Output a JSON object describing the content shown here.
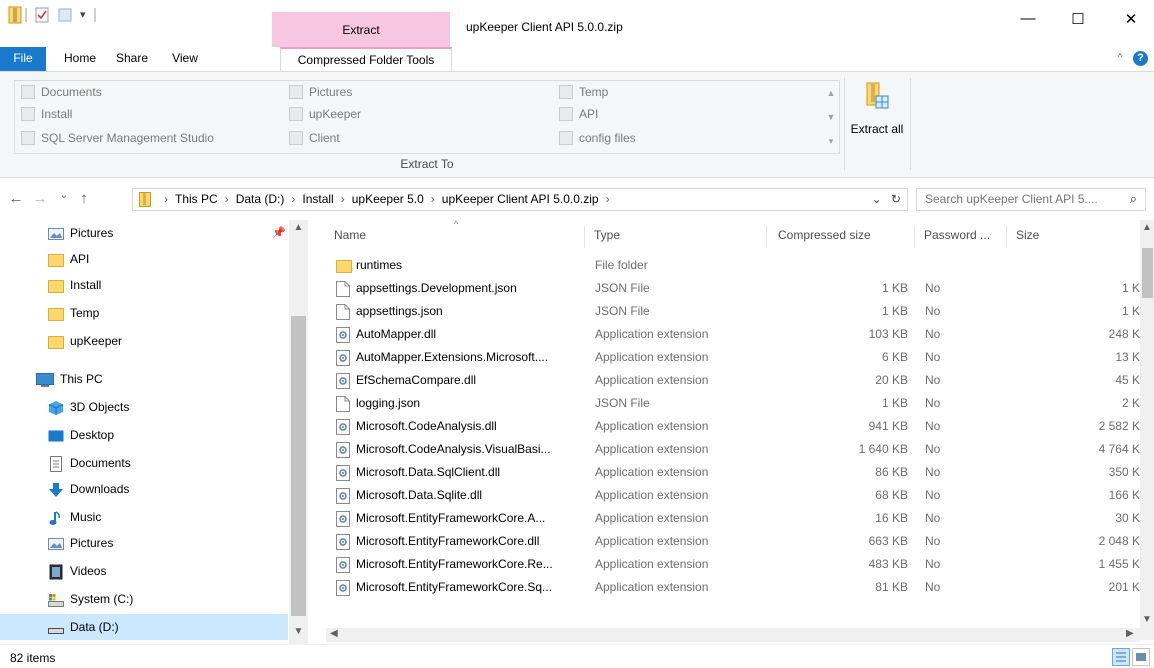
{
  "window": {
    "title": "upKeeper Client API 5.0.0.zip",
    "context_tab": "Extract",
    "minimize": "—",
    "maximize": "☐",
    "close": "✕"
  },
  "ribbon": {
    "tabs": [
      "File",
      "Home",
      "Share",
      "View",
      "Compressed Folder Tools"
    ],
    "extract_to": {
      "columns": [
        [
          "Documents",
          "Install",
          "SQL Server Management Studio"
        ],
        [
          "Pictures",
          "upKeeper",
          "Client"
        ],
        [
          "Temp",
          "API",
          "config files"
        ]
      ],
      "label": "Extract To"
    },
    "extract_all": "Extract all",
    "collapse_icon": "^",
    "help_icon": "?"
  },
  "address": {
    "crumbs": [
      "This PC",
      "Data (D:)",
      "Install",
      "upKeeper 5.0",
      "upKeeper Client API 5.0.0.zip"
    ],
    "search_placeholder": "Search upKeeper Client API 5...."
  },
  "nav": {
    "items": [
      {
        "label": "Pictures",
        "icon": "pictures-icon"
      },
      {
        "label": "API",
        "icon": "folder-icon"
      },
      {
        "label": "Install",
        "icon": "folder-icon"
      },
      {
        "label": "Temp",
        "icon": "folder-icon"
      },
      {
        "label": "upKeeper",
        "icon": "folder-icon"
      },
      {
        "label": "This PC",
        "icon": "this-pc-icon"
      },
      {
        "label": "3D Objects",
        "icon": "3d-objects-icon"
      },
      {
        "label": "Desktop",
        "icon": "desktop-icon"
      },
      {
        "label": "Documents",
        "icon": "documents-icon"
      },
      {
        "label": "Downloads",
        "icon": "downloads-icon"
      },
      {
        "label": "Music",
        "icon": "music-icon"
      },
      {
        "label": "Pictures",
        "icon": "pictures-icon"
      },
      {
        "label": "Videos",
        "icon": "videos-icon"
      },
      {
        "label": "System (C:)",
        "icon": "system-drive-icon"
      },
      {
        "label": "Data (D:)",
        "icon": "drive-icon"
      }
    ]
  },
  "filelist": {
    "columns": [
      "Name",
      "Type",
      "Compressed size",
      "Password ...",
      "Size"
    ],
    "rows": [
      {
        "name": "runtimes",
        "type": "File folder",
        "csize": "",
        "pw": "",
        "size": "",
        "icon": "folder-icon"
      },
      {
        "name": "appsettings.Development.json",
        "type": "JSON File",
        "csize": "1 KB",
        "pw": "No",
        "size": "1 K",
        "icon": "file-icon"
      },
      {
        "name": "appsettings.json",
        "type": "JSON File",
        "csize": "1 KB",
        "pw": "No",
        "size": "1 K",
        "icon": "file-icon"
      },
      {
        "name": "AutoMapper.dll",
        "type": "Application extension",
        "csize": "103 KB",
        "pw": "No",
        "size": "248 K",
        "icon": "dll-icon"
      },
      {
        "name": "AutoMapper.Extensions.Microsoft....",
        "type": "Application extension",
        "csize": "6 KB",
        "pw": "No",
        "size": "13 K",
        "icon": "dll-icon"
      },
      {
        "name": "EfSchemaCompare.dll",
        "type": "Application extension",
        "csize": "20 KB",
        "pw": "No",
        "size": "45 K",
        "icon": "dll-icon"
      },
      {
        "name": "logging.json",
        "type": "JSON File",
        "csize": "1 KB",
        "pw": "No",
        "size": "2 K",
        "icon": "file-icon"
      },
      {
        "name": "Microsoft.CodeAnalysis.dll",
        "type": "Application extension",
        "csize": "941 KB",
        "pw": "No",
        "size": "2 582 K",
        "icon": "dll-icon"
      },
      {
        "name": "Microsoft.CodeAnalysis.VisualBasi...",
        "type": "Application extension",
        "csize": "1 640 KB",
        "pw": "No",
        "size": "4 764 K",
        "icon": "dll-icon"
      },
      {
        "name": "Microsoft.Data.SqlClient.dll",
        "type": "Application extension",
        "csize": "86 KB",
        "pw": "No",
        "size": "350 K",
        "icon": "dll-icon"
      },
      {
        "name": "Microsoft.Data.Sqlite.dll",
        "type": "Application extension",
        "csize": "68 KB",
        "pw": "No",
        "size": "166 K",
        "icon": "dll-icon"
      },
      {
        "name": "Microsoft.EntityFrameworkCore.A...",
        "type": "Application extension",
        "csize": "16 KB",
        "pw": "No",
        "size": "30 K",
        "icon": "dll-icon"
      },
      {
        "name": "Microsoft.EntityFrameworkCore.dll",
        "type": "Application extension",
        "csize": "663 KB",
        "pw": "No",
        "size": "2 048 K",
        "icon": "dll-icon"
      },
      {
        "name": "Microsoft.EntityFrameworkCore.Re...",
        "type": "Application extension",
        "csize": "483 KB",
        "pw": "No",
        "size": "1 455 K",
        "icon": "dll-icon"
      },
      {
        "name": "Microsoft.EntityFrameworkCore.Sq...",
        "type": "Application extension",
        "csize": "81 KB",
        "pw": "No",
        "size": "201 K",
        "icon": "dll-icon"
      }
    ]
  },
  "status": {
    "count": "82 items"
  },
  "colors": {
    "file_tab": "#1979ca",
    "context_tab": "#f7c6e0",
    "selection": "#cce8ff",
    "folder": "#ffd76a"
  }
}
